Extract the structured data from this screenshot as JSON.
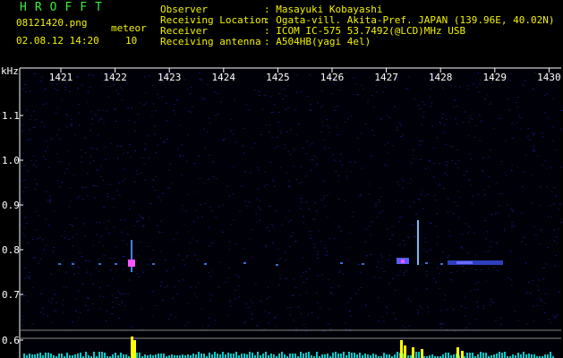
{
  "header": {
    "app_title": "HROFFT",
    "filename": "08121420.png",
    "timestamp": "02.08.12 14:20",
    "meteor_label": "meteor",
    "meteor_count": "10"
  },
  "station_info": [
    {
      "label": "Observer",
      "value": ": Masayuki Kobayashi"
    },
    {
      "label": "Receiving Location",
      "value": ": Ogata-vill. Akita-Pref. JAPAN (139.96E, 40.02N)"
    },
    {
      "label": "Receiver",
      "value": ": ICOM IC-575 53.7492(@LCD)MHz USB"
    },
    {
      "label": "Receiving antenna",
      "value": ": A504HB(yagi 4el)"
    }
  ],
  "axes": {
    "y_unit": "kHz",
    "x_ticks": [
      "1421",
      "1422",
      "1423",
      "1424",
      "1425",
      "1426",
      "1427",
      "1428",
      "1429",
      "1430"
    ],
    "y_ticks": [
      "1.1",
      "1.0",
      "0.9",
      "0.8",
      "0.7",
      "0.6"
    ]
  },
  "colors": {
    "background": "#000000",
    "noise": "#1a1a6e",
    "text_green": "#33ee33",
    "text_yellow": "#f2f200",
    "grid": "#ffffff",
    "echo": "#ff55ff",
    "level_bar": "#ffff00",
    "level_low": "#00cccc"
  }
}
